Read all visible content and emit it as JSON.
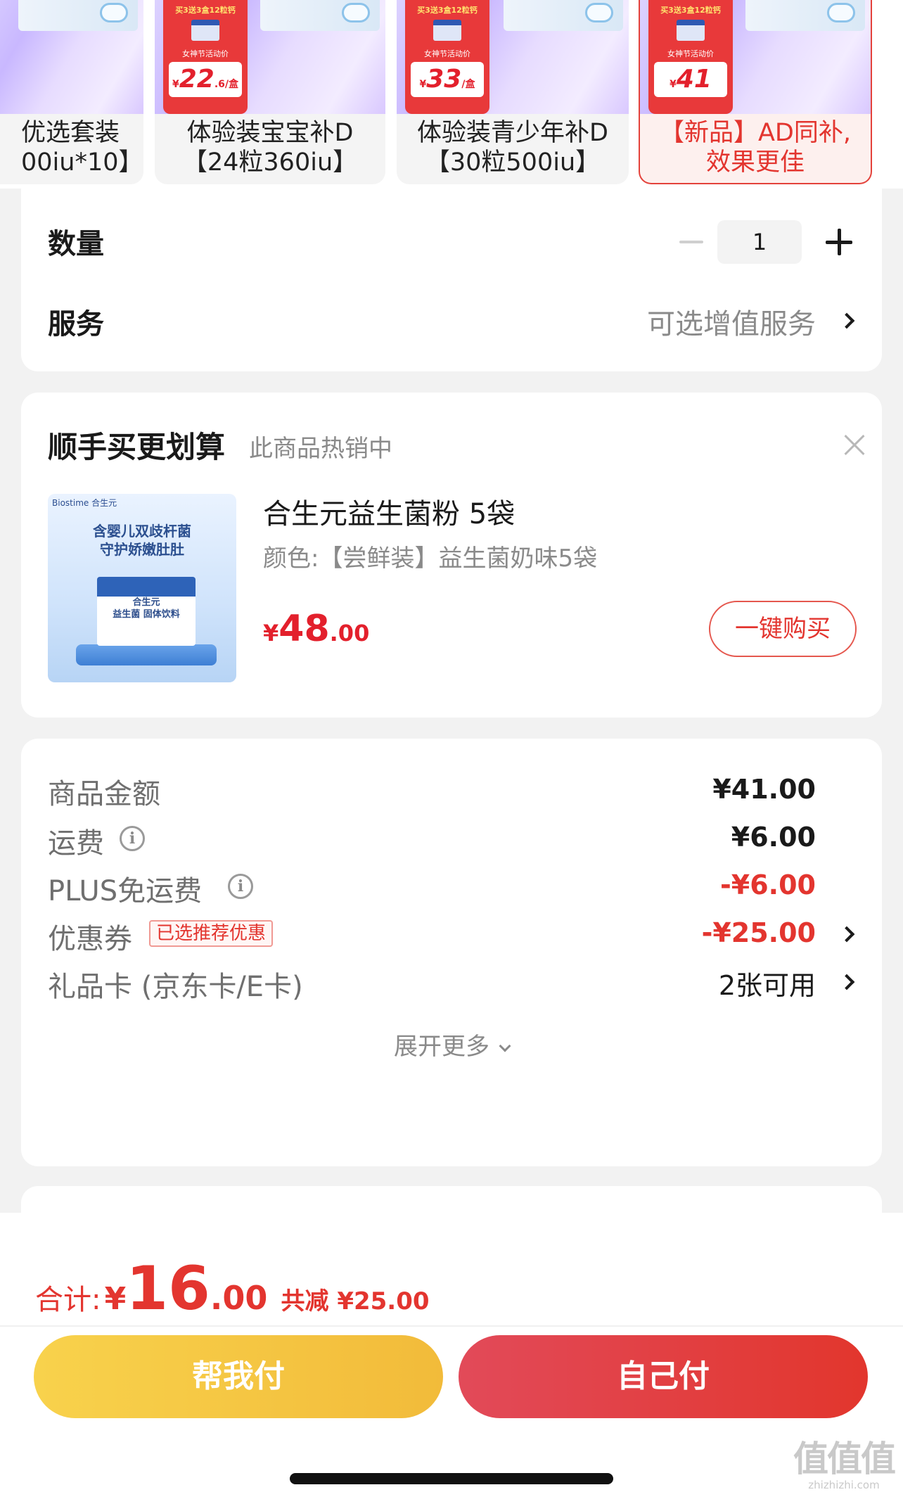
{
  "variants": [
    {
      "label_line1": "优选套装",
      "label_line2": "00iu*10】"
    },
    {
      "promo": "买3送3盒12粒钙",
      "event": "女神节活动价",
      "price_int": "22",
      "price_dec": ".6",
      "unit": "/盒",
      "label_line1": "体验装宝宝补D",
      "label_line2": "【24粒360iu】"
    },
    {
      "promo": "买3送3盒12粒钙",
      "event": "女神节活动价",
      "price_int": "33",
      "price_dec": "",
      "unit": "/盒",
      "label_line1": "体验装青少年补D",
      "label_line2": "【30粒500iu】"
    },
    {
      "promo": "买3送3盒12粒钙",
      "event": "女神节活动价",
      "price_int": "41",
      "price_dec": "",
      "unit": "",
      "label_line1": "【新品】AD同补,",
      "label_line2": "效果更佳"
    }
  ],
  "quantity": {
    "label": "数量",
    "value": "1"
  },
  "service": {
    "label": "服务",
    "value": "可选增值服务"
  },
  "buy_together": {
    "title": "顺手买更划算",
    "subtitle": "此商品热销中",
    "product": {
      "image_brand": "Biostime 合生元",
      "image_headline_1": "含婴儿双歧杆菌",
      "image_headline_2": "守护娇嫩肚肚",
      "image_box_1": "合生元",
      "image_box_2": "益生菌 固体饮料",
      "name": "合生元益生菌粉 5袋",
      "color": "颜色:【尝鲜装】益生菌奶味5袋",
      "price_currency": "¥",
      "price_int": "48",
      "price_dec": ".00",
      "button": "一键购买"
    }
  },
  "summary": {
    "goods": {
      "label": "商品金额",
      "value": "¥41.00"
    },
    "shipping": {
      "label": "运费",
      "value": "¥6.00"
    },
    "plus_free": {
      "label": "PLUS免运费",
      "value": "-¥6.00"
    },
    "coupon": {
      "label": "优惠券",
      "tag": "已选推荐优惠",
      "value": "-¥25.00"
    },
    "giftcard": {
      "label": "礼品卡 (京东卡/E卡)",
      "value": "2张可用"
    },
    "expand": "展开更多"
  },
  "bottom": {
    "total_label": "合计:",
    "total_currency": "¥",
    "total_int": "16",
    "total_dec": ".00",
    "saved": "共减 ¥25.00",
    "help_pay": "帮我付",
    "self_pay": "自己付"
  },
  "watermark": {
    "big": "值值值",
    "small": "zhizhizhi.com"
  },
  "colors": {
    "accent_red": "#e3352f",
    "help_pay_yellow": "#f5c642",
    "self_pay_red": "#e2413f"
  }
}
